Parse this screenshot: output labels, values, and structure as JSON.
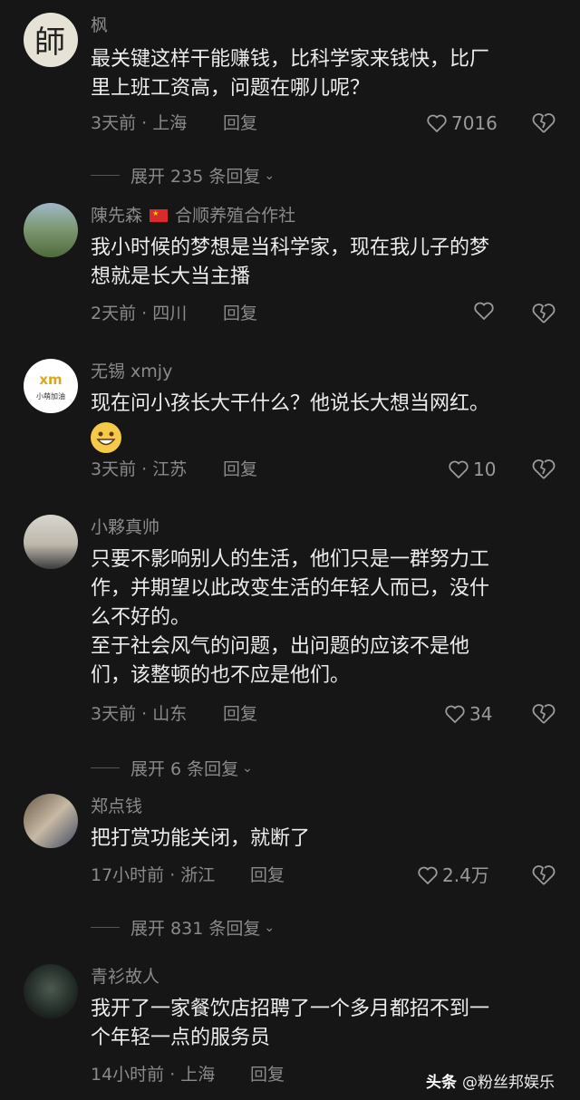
{
  "comments": [
    {
      "username": "枫",
      "lines": [
        "最关键这样干能赚钱，比科学家来钱快，比厂",
        "里上班工资高，问题在哪儿呢？"
      ],
      "time_loc": "3天前 · 上海",
      "reply": "回复",
      "likes": "7016",
      "expand": "展开 235 条回复"
    },
    {
      "username": "陳先森",
      "tag": "合顺养殖合作社",
      "lines": [
        "我小时候的梦想是当科学家，现在我儿子的梦",
        "想就是长大当主播"
      ],
      "time_loc": "2天前 · 四川",
      "reply": "回复",
      "likes": ""
    },
    {
      "username": "无锡 xmjy",
      "avatar_text": "小萌加油",
      "lines": [
        "现在问小孩长大干什么？他说长大想当网红。"
      ],
      "time_loc": "3天前 · 江苏",
      "reply": "回复",
      "likes": "10"
    },
    {
      "username": "小夥真帅",
      "lines": [
        "只要不影响别人的生活，他们只是一群努力工",
        "作，并期望以此改变生活的年轻人而已，没什",
        "么不好的。",
        "至于社会风气的问题，出问题的应该不是他",
        "们，该整顿的也不应是他们。"
      ],
      "time_loc": "3天前 · 山东",
      "reply": "回复",
      "likes": "34",
      "expand": "展开 6 条回复"
    },
    {
      "username": "郑点钱",
      "lines": [
        "把打赏功能关闭，就断了"
      ],
      "time_loc": "17小时前 · 浙江",
      "reply": "回复",
      "likes": "2.4万",
      "expand": "展开 831 条回复"
    },
    {
      "username": "青衫故人",
      "lines": [
        "我开了一家餐饮店招聘了一个多月都招不到一",
        "个年轻一点的服务员"
      ],
      "time_loc": "14小时前 · 上海",
      "reply": "回复",
      "likes": ""
    }
  ],
  "watermark": {
    "brand": "头条",
    "handle": "@粉丝邦娱乐"
  }
}
